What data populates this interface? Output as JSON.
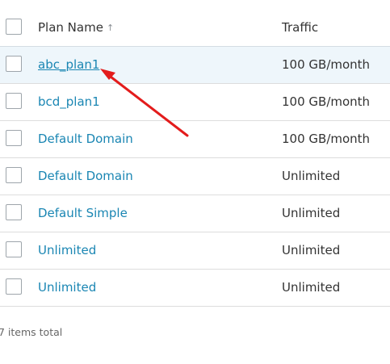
{
  "table": {
    "columns": {
      "plan_name": "Plan Name",
      "traffic": "Traffic"
    },
    "sort_indicator": "↑",
    "rows": [
      {
        "plan_name": "abc_plan1",
        "traffic": "100 GB/month"
      },
      {
        "plan_name": "bcd_plan1",
        "traffic": "100 GB/month"
      },
      {
        "plan_name": "Default Domain",
        "traffic": "100 GB/month"
      },
      {
        "plan_name": "Default Domain",
        "traffic": "Unlimited"
      },
      {
        "plan_name": "Default Simple",
        "traffic": "Unlimited"
      },
      {
        "plan_name": "Unlimited",
        "traffic": "Unlimited"
      },
      {
        "plan_name": "Unlimited",
        "traffic": "Unlimited"
      }
    ]
  },
  "footer": {
    "items_total": "7 items total"
  },
  "colors": {
    "link": "#1a86b3",
    "highlight_row": "#eef6fb",
    "annotation_arrow": "#e31c1c"
  }
}
